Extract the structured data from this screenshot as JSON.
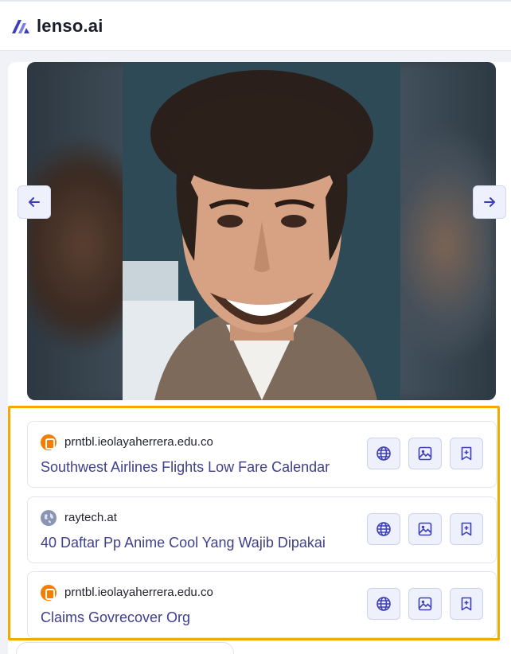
{
  "app": {
    "brand": "lenso.ai",
    "brand_color": "#3d3fb8",
    "accent_highlight": "#f5a800"
  },
  "viewer": {
    "prev_icon": "arrow-left-icon",
    "next_icon": "arrow-right-icon"
  },
  "results": [
    {
      "favicon": "blogger-icon",
      "domain": "prntbl.ieolayaherrera.edu.co",
      "title": "Southwest Airlines Flights Low Fare Calendar"
    },
    {
      "favicon": "globe-icon",
      "domain": "raytech.at",
      "title": "40 Daftar Pp Anime Cool Yang Wajib Dipakai"
    },
    {
      "favicon": "blogger-icon",
      "domain": "prntbl.ieolayaherrera.edu.co",
      "title": "Claims Govrecover Org"
    }
  ],
  "result_actions": {
    "visit_icon": "globe-icon",
    "image_icon": "image-icon",
    "save_icon": "bookmark-plus-icon"
  }
}
